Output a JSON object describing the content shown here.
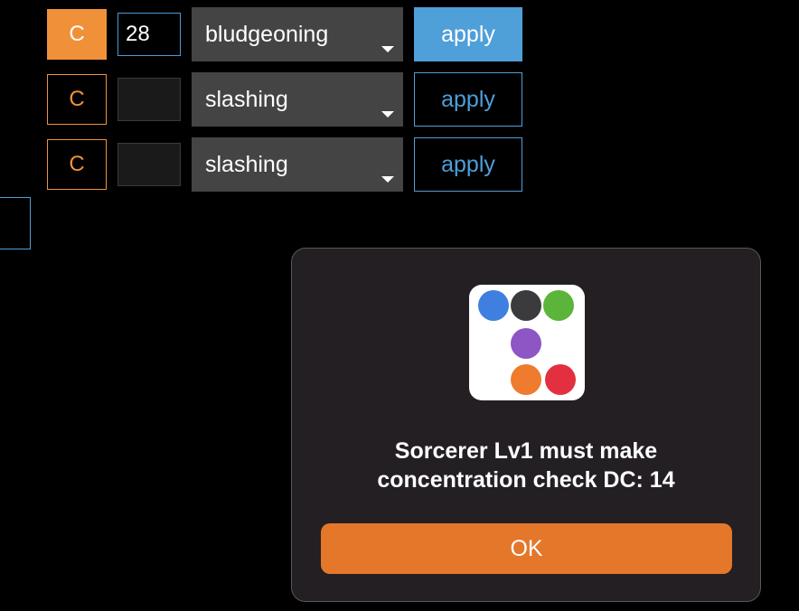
{
  "rows": [
    {
      "concentration_label": "C",
      "amount_value": "28",
      "damage_type": "bludgeoning",
      "apply_label": "apply"
    },
    {
      "concentration_label": "C",
      "amount_value": "",
      "damage_type": "slashing",
      "apply_label": "apply"
    },
    {
      "concentration_label": "C",
      "amount_value": "",
      "damage_type": "slashing",
      "apply_label": "apply"
    }
  ],
  "dialog": {
    "message_line1": "Sorcerer Lv1 must make",
    "message_line2": "concentration check DC: 14",
    "ok_label": "OK",
    "icon": "app-dots-icon"
  },
  "colors": {
    "orange": "#f0913a",
    "blue": "#4f9fd8",
    "select_bg": "#444444",
    "dialog_bg": "#231f23",
    "ok_button": "#e4772a"
  }
}
